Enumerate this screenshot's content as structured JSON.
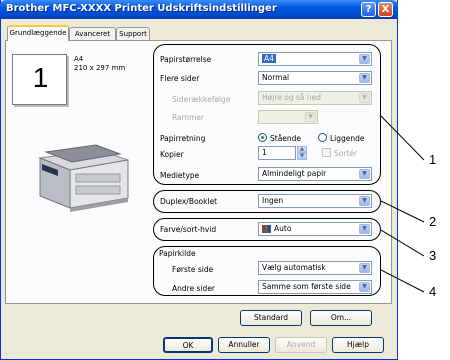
{
  "window": {
    "title": "Brother MFC-XXXX Printer Udskriftsindstillinger"
  },
  "titlebar_buttons": {
    "help": "?",
    "close": "X"
  },
  "tabs": [
    {
      "label": "Grundlæggende"
    },
    {
      "label": "Avanceret"
    },
    {
      "label": "Support"
    }
  ],
  "preview": {
    "page_number": "1",
    "paper_name": "A4",
    "paper_size": "210 x 297 mm"
  },
  "basic": {
    "paper_size": {
      "label": "Papirstørrelse",
      "value": "A4"
    },
    "multiple_pages": {
      "label": "Flere sider",
      "value": "Normal"
    },
    "page_order": {
      "label": "Siderækkefølge",
      "value": "Højre og så ned"
    },
    "border": {
      "label": "Rammer",
      "value": ""
    },
    "orientation": {
      "label": "Papirretning",
      "portrait": "Stående",
      "landscape": "Liggende"
    },
    "copies": {
      "label": "Kopier",
      "value": "1",
      "collate_label": "Sortér"
    },
    "media_type": {
      "label": "Medietype",
      "value": "Almindeligt papir"
    }
  },
  "duplex": {
    "label": "Duplex/Booklet",
    "value": "Ingen"
  },
  "color": {
    "label": "Farve/sort-hvid",
    "value": "Auto"
  },
  "paper_source": {
    "label": "Papirkilde",
    "first_page": {
      "label": "Første side",
      "value": "Vælg automatisk"
    },
    "other_pages": {
      "label": "Andre sider",
      "value": "Samme som første side"
    }
  },
  "panel_buttons": {
    "default": "Standard",
    "about": "Om..."
  },
  "dialog_buttons": {
    "ok": "OK",
    "cancel": "Annuller",
    "apply": "Anvend",
    "help": "Hjælp"
  },
  "callouts": [
    "1",
    "2",
    "3",
    "4"
  ]
}
